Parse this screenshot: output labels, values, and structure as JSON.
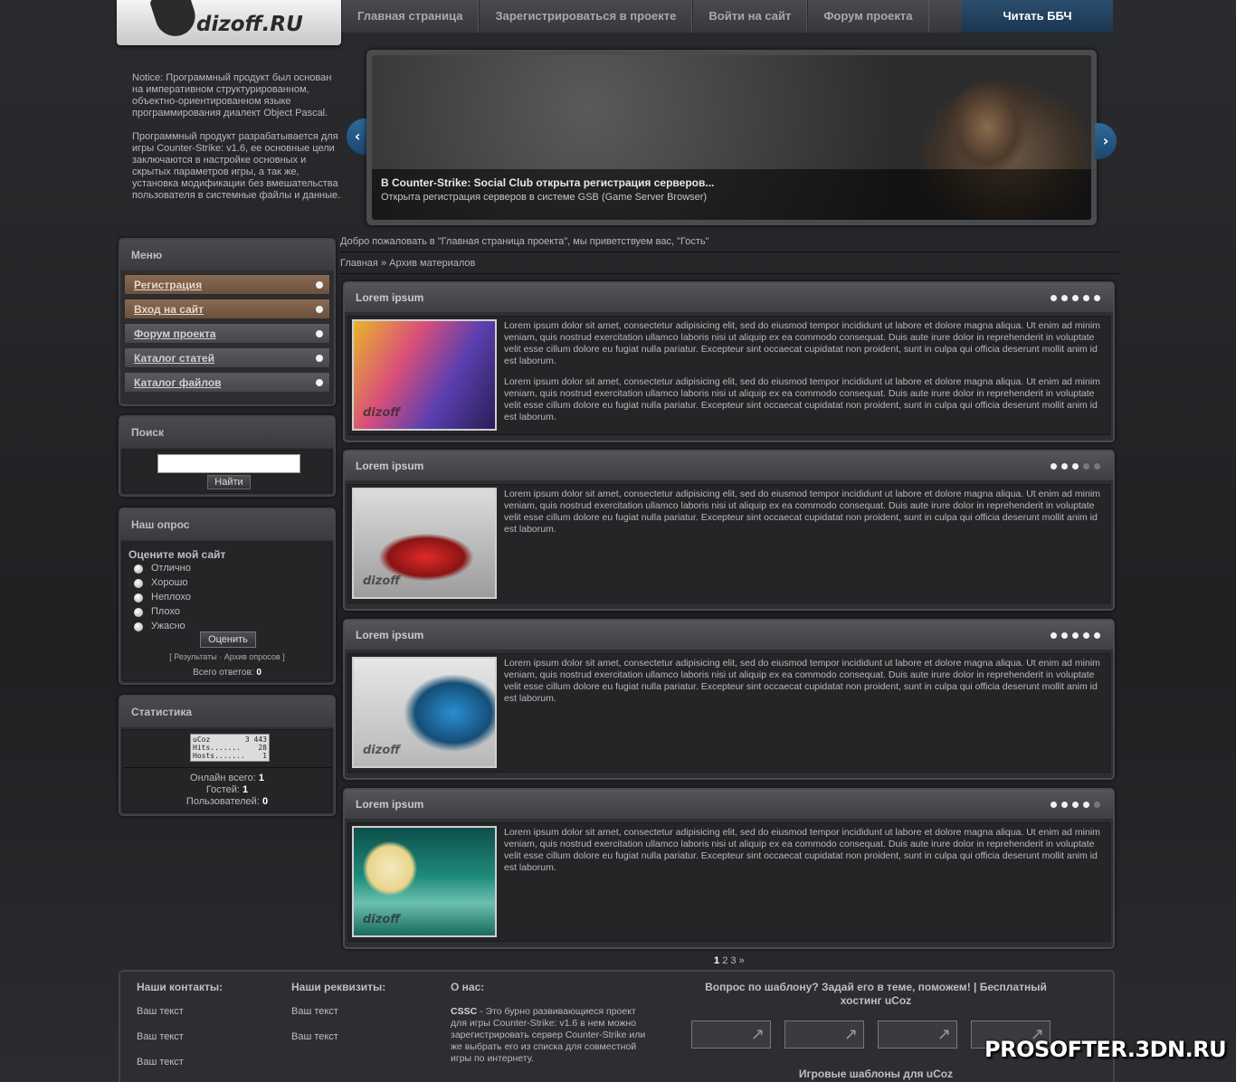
{
  "logo": {
    "text": "dizoff.RU"
  },
  "nav": {
    "items": [
      "Главная страница",
      "Зарегистрироваться в проекте",
      "Войти на сайт",
      "Форум проекта"
    ],
    "cta": "Читать ББЧ"
  },
  "notice": {
    "p1": "Notice: Программный продукт был основан на императивном структурированном, объектно-ориентированном языке программирования диалект Object Pascal.",
    "p2": "Программный продукт разрабатывается для игры Counter-Strike: v1.6, ее основные цели заключаются в настройке основных и скрытых параметров игры, а так же, установка модификации без вмешательства пользователя в системные файлы и данные."
  },
  "slider": {
    "title": "В Counter-Strike: Social Club открыта регистрация серверов...",
    "subtitle": "Открыта регистрация серверов в системе GSB (Game Server Browser)",
    "prev_icon": "chevron-left-icon",
    "next_icon": "chevron-right-icon"
  },
  "welcome": "Добро пожаловать в \"Главная страница проекта\", мы приветствуем вас, \"Гость\"",
  "breadcrumb": {
    "home": "Главная",
    "sep": "»",
    "current": "Архив материалов"
  },
  "menu": {
    "title": "Меню",
    "items": [
      {
        "label": "Регистрация",
        "active": true
      },
      {
        "label": "Вход на сайт",
        "active": true
      },
      {
        "label": "Форум проекта",
        "active": false
      },
      {
        "label": "Каталог статей",
        "active": false
      },
      {
        "label": "Каталог файлов",
        "active": false
      }
    ]
  },
  "search": {
    "title": "Поиск",
    "button": "Найти",
    "value": ""
  },
  "poll": {
    "title": "Наш опрос",
    "question": "Оцените мой сайт",
    "options": [
      "Отлично",
      "Хорошо",
      "Неплохо",
      "Плохо",
      "Ужасно"
    ],
    "button": "Оценить",
    "links": "[ Результаты · Архив опросов ]",
    "total_label": "Всего ответов:",
    "total_value": "0"
  },
  "stats": {
    "title": "Статистика",
    "counter": {
      "brand": "uCoz",
      "total": "3 443",
      "hits_label": "Hits.......",
      "hits": "28",
      "hosts_label": "Hosts.......",
      "hosts": "1"
    },
    "online_label": "Онлайн всего:",
    "online": "1",
    "guests_label": "Гостей:",
    "guests": "1",
    "users_label": "Пользователей:",
    "users": "0"
  },
  "articles": [
    {
      "title": "Lorem ipsum",
      "rating": 5,
      "p1": "Lorem ipsum dolor sit amet, consectetur adipisicing elit, sed do eiusmod tempor incididunt ut labore et dolore magna aliqua. Ut enim ad minim veniam, quis nostrud exercitation ullamco laboris nisi ut aliquip ex ea commodo consequat. Duis aute irure dolor in reprehenderit in voluptate velit esse cillum dolore eu fugiat nulla pariatur. Excepteur sint occaecat cupidatat non proident, sunt in culpa qui officia deserunt mollit anim id est laborum.",
      "p2": "Lorem ipsum dolor sit amet, consectetur adipisicing elit, sed do eiusmod tempor incididunt ut labore et dolore magna aliqua. Ut enim ad minim veniam, quis nostrud exercitation ullamco laboris nisi ut aliquip ex ea commodo consequat. Duis aute irure dolor in reprehenderit in voluptate velit esse cillum dolore eu fugiat nulla pariatur. Excepteur sint occaecat cupidatat non proident, sunt in culpa qui officia deserunt mollit anim id est laborum."
    },
    {
      "title": "Lorem ipsum",
      "rating": 3,
      "p1": "Lorem ipsum dolor sit amet, consectetur adipisicing elit, sed do eiusmod tempor incididunt ut labore et dolore magna aliqua. Ut enim ad minim veniam, quis nostrud exercitation ullamco laboris nisi ut aliquip ex ea commodo consequat. Duis aute irure dolor in reprehenderit in voluptate velit esse cillum dolore eu fugiat nulla pariatur. Excepteur sint occaecat cupidatat non proident, sunt in culpa qui officia deserunt mollit anim id est laborum.",
      "p2": ""
    },
    {
      "title": "Lorem ipsum",
      "rating": 5,
      "p1": "Lorem ipsum dolor sit amet, consectetur adipisicing elit, sed do eiusmod tempor incididunt ut labore et dolore magna aliqua. Ut enim ad minim veniam, quis nostrud exercitation ullamco laboris nisi ut aliquip ex ea commodo consequat. Duis aute irure dolor in reprehenderit in voluptate velit esse cillum dolore eu fugiat nulla pariatur. Excepteur sint occaecat cupidatat non proident, sunt in culpa qui officia deserunt mollit anim id est laborum.",
      "p2": ""
    },
    {
      "title": "Lorem ipsum",
      "rating": 4,
      "p1": "Lorem ipsum dolor sit amet, consectetur adipisicing elit, sed do eiusmod tempor incididunt ut labore et dolore magna aliqua. Ut enim ad minim veniam, quis nostrud exercitation ullamco laboris nisi ut aliquip ex ea commodo consequat. Duis aute irure dolor in reprehenderit in voluptate velit esse cillum dolore eu fugiat nulla pariatur. Excepteur sint occaecat cupidatat non proident, sunt in culpa qui officia deserunt mollit anim id est laborum.",
      "p2": ""
    }
  ],
  "thumb_watermark": "dizoff",
  "pager": {
    "current": "1",
    "pages": [
      "2",
      "3"
    ],
    "next": "»"
  },
  "footer": {
    "contacts_title": "Наши контакты:",
    "contacts": [
      "Ваш текст",
      "Ваш текст",
      "Ваш текст"
    ],
    "requisites_title": "Наши реквизиты:",
    "requisites": [
      "Ваш текст",
      "Ваш текст"
    ],
    "about_title": "О нас:",
    "about_brand": "CSSC",
    "about_text": " - Это бурно развивающиеся проект для игры Counter-Strike: v1.6 в нем можно зарегистрировать сервер Counter-Strike или же выбрать его из списка для совместной игры по интернету.",
    "question": "Вопрос по шаблону? Задай его в теме, поможем! | Бесплатный хостинг uCoz",
    "games": "Игровые шаблоны для uCoz"
  },
  "watermark": "PROSOFTER.3DN.RU"
}
